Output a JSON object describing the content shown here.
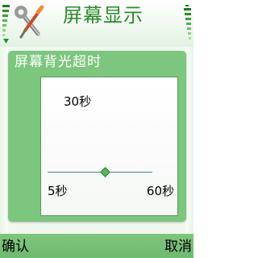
{
  "header": {
    "title": "屏幕显示",
    "app_icon": "wrench-screwdriver-icon"
  },
  "status": {
    "signal_icon": "signal-strength-icon",
    "battery_icon": "battery-level-icon"
  },
  "dialog": {
    "title": "屏幕背光超时",
    "current_value": "30秒",
    "min_label": "5秒",
    "max_label": "60秒",
    "slider_level_percent": 55
  },
  "softkeys": {
    "left": "确认",
    "right": "取消"
  },
  "colors": {
    "title_text": "#2a8c2a",
    "dialog_frame": "#7dc67d",
    "softkey_bar": "#7fc67f",
    "slider_thumb": "#57b857",
    "slider_track": "#4b7f9a"
  }
}
